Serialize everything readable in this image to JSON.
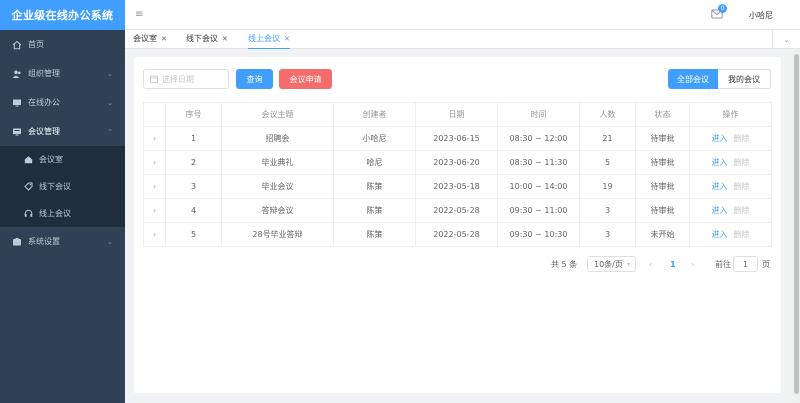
{
  "app": {
    "title": "企业级在线办公系统"
  },
  "sidebar": {
    "items": [
      {
        "label": "首页",
        "icon": "home-icon"
      },
      {
        "label": "组织管理",
        "icon": "users-icon"
      },
      {
        "label": "在线办公",
        "icon": "monitor-icon"
      },
      {
        "label": "会议管理",
        "icon": "meeting-icon"
      },
      {
        "label": "系统设置",
        "icon": "settings-icon"
      }
    ],
    "meeting_sub": [
      {
        "label": "会议室",
        "icon": "room-icon"
      },
      {
        "label": "线下会议",
        "icon": "tag-icon"
      },
      {
        "label": "线上会议",
        "icon": "headset-icon"
      }
    ]
  },
  "header": {
    "user_name": "小哈尼",
    "message_count": "0"
  },
  "tabs": [
    {
      "label": "会议室"
    },
    {
      "label": "线下会议"
    },
    {
      "label": "线上会议"
    }
  ],
  "toolbar": {
    "date_placeholder": "选择日期",
    "query_label": "查询",
    "apply_label": "会议申请",
    "all_label": "全部会议",
    "mine_label": "我的会议"
  },
  "table": {
    "columns": [
      "序号",
      "会议主题",
      "创建者",
      "日期",
      "时间",
      "人数",
      "状态",
      "操作"
    ],
    "rows": [
      {
        "no": "1",
        "topic": "招聘会",
        "creator": "小哈尼",
        "date": "2023-06-15",
        "time": "08:30 ~ 12:00",
        "count": "21",
        "status": "待审批"
      },
      {
        "no": "2",
        "topic": "毕业典礼",
        "creator": "哈尼",
        "date": "2023-06-20",
        "time": "08:30 ~ 11:30",
        "count": "5",
        "status": "待审批"
      },
      {
        "no": "3",
        "topic": "毕业会议",
        "creator": "陈策",
        "date": "2023-05-18",
        "time": "10:00 ~ 14:00",
        "count": "19",
        "status": "待审批"
      },
      {
        "no": "4",
        "topic": "答辩会议",
        "creator": "陈策",
        "date": "2022-05-28",
        "time": "09:30 ~ 11:00",
        "count": "3",
        "status": "待审批"
      },
      {
        "no": "5",
        "topic": "28号毕业答辩",
        "creator": "陈策",
        "date": "2022-05-28",
        "time": "09:30 ~ 10:30",
        "count": "3",
        "status": "未开始"
      }
    ],
    "enter_label": "进入",
    "delete_label": "删除"
  },
  "pagination": {
    "total_text": "共 5 条",
    "page_size": "10条/页",
    "current_page": "1",
    "goto_label": "前往",
    "goto_value": "1",
    "page_unit": "页"
  }
}
